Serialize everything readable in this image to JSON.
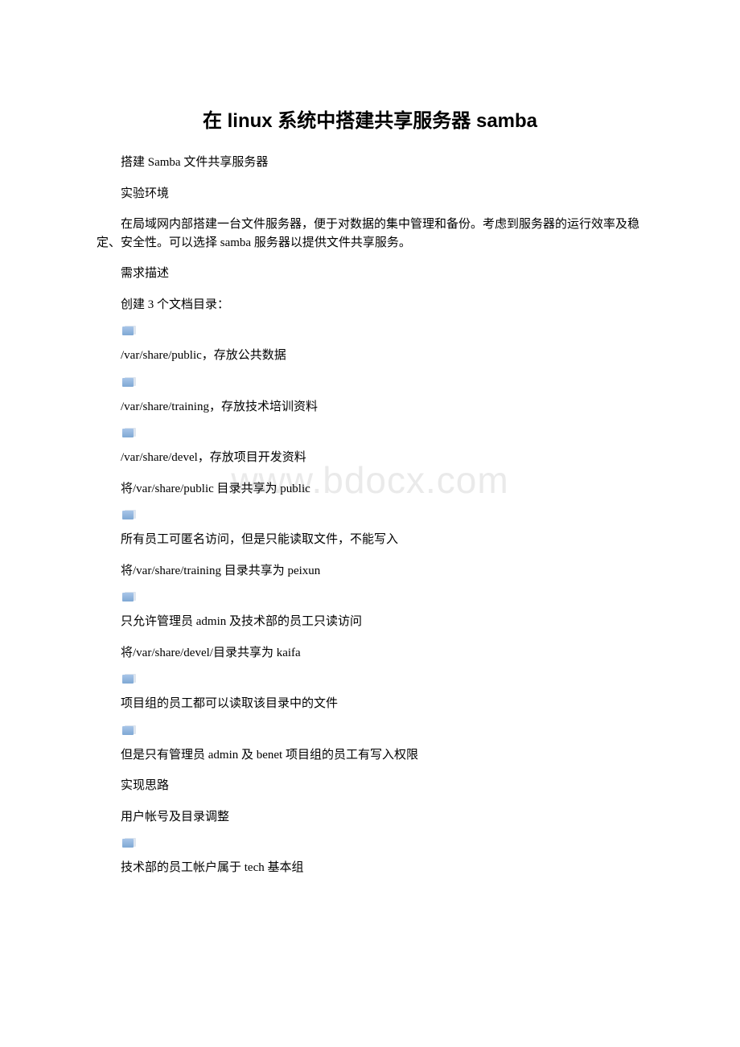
{
  "title": "在 linux 系统中搭建共享服务器 samba",
  "watermark": "www.bdocx.com",
  "lines": [
    {
      "type": "para",
      "cls": "indent",
      "text": "搭建 Samba 文件共享服务器"
    },
    {
      "type": "para",
      "cls": "indent",
      "text": "实验环境"
    },
    {
      "type": "para",
      "cls": "indent",
      "text": "在局域网内部搭建一台文件服务器，便于对数据的集中管理和备份。考虑到服务器的运行效率及稳定、安全性。可以选择 samba 服务器以提供文件共享服务。"
    },
    {
      "type": "para",
      "cls": "indent",
      "text": "需求描述"
    },
    {
      "type": "para",
      "cls": "indent",
      "text": "创建 3 个文档目录："
    },
    {
      "type": "bullet"
    },
    {
      "type": "para",
      "cls": "no-indent",
      "text": " /var/share/public，存放公共数据"
    },
    {
      "type": "bullet"
    },
    {
      "type": "para",
      "cls": "no-indent",
      "text": " /var/share/training，存放技术培训资料"
    },
    {
      "type": "bullet"
    },
    {
      "type": "para",
      "cls": "no-indent",
      "text": " /var/share/devel，存放项目开发资料"
    },
    {
      "type": "para",
      "cls": "indent",
      "text": "将/var/share/public 目录共享为 public"
    },
    {
      "type": "bullet"
    },
    {
      "type": "para",
      "cls": "no-indent",
      "text": " 所有员工可匿名访问，但是只能读取文件，不能写入"
    },
    {
      "type": "para",
      "cls": "indent",
      "text": "将/var/share/training 目录共享为 peixun"
    },
    {
      "type": "bullet"
    },
    {
      "type": "para",
      "cls": "no-indent",
      "text": " 只允许管理员 admin 及技术部的员工只读访问"
    },
    {
      "type": "para",
      "cls": "indent",
      "text": "将/var/share/devel/目录共享为 kaifa"
    },
    {
      "type": "bullet"
    },
    {
      "type": "para",
      "cls": "no-indent",
      "text": " 项目组的员工都可以读取该目录中的文件"
    },
    {
      "type": "bullet"
    },
    {
      "type": "para",
      "cls": "no-indent",
      "text": " 但是只有管理员 admin 及 benet 项目组的员工有写入权限"
    },
    {
      "type": "para",
      "cls": "indent",
      "text": "实现思路"
    },
    {
      "type": "para",
      "cls": "indent",
      "text": "用户帐号及目录调整"
    },
    {
      "type": "bullet"
    },
    {
      "type": "para",
      "cls": "no-indent",
      "text": " 技术部的员工帐户属于 tech 基本组"
    }
  ]
}
